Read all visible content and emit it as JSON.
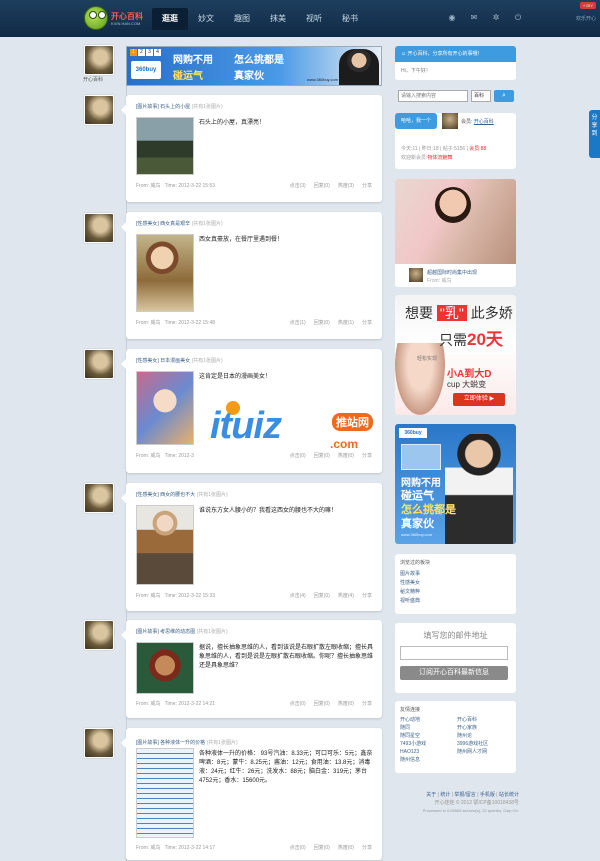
{
  "header": {
    "logo_text": "开心百科",
    "logo_sub": "KXIN.HAN.COM",
    "nav": [
      "逛逛",
      "妙文",
      "趣图",
      "抹美",
      "视听",
      "秘书"
    ],
    "diy": "+ DIY",
    "username": "欢乐开心"
  },
  "banner_ad": {
    "nums": [
      "1",
      "2",
      "3",
      "4"
    ],
    "logo": "360buy",
    "line1": "网购不用",
    "line2": "碰运气",
    "line3": "怎么挑都是",
    "line4": "真家伙",
    "url": "www.360buy.com"
  },
  "avatar_label": "开心百科",
  "posts": [
    {
      "category": "[图片故事]",
      "title": "石头上的小屋",
      "count": "(共有1张图片)",
      "text": "石头上的小屋，真漂亮！",
      "from": "From: 威鸟",
      "time": "Time: 2012-3-22 15:53",
      "actions": [
        "点击(3)",
        "回复(0)",
        "热度(3)",
        "分享"
      ]
    },
    {
      "category": "[性感美女]",
      "title": "西女真是艰辛",
      "count": "(共有1张图片)",
      "text": "西女真豪放，在餐厅里遇到餐！",
      "from": "From: 威鸟",
      "time": "Time: 2012-3-22 15:48",
      "actions": [
        "点击(1)",
        "回复(0)",
        "热度(1)",
        "分享"
      ]
    },
    {
      "category": "[性感美女]",
      "title": "日本漫画美女",
      "count": "(共有1张图片)",
      "text": "这肯定是日本的漫画美女！",
      "from": "From: 威鸟",
      "time": "Time: 2012-3",
      "actions": [
        "点击(0)",
        "回复(0)",
        "热度(0)",
        "分享"
      ]
    },
    {
      "category": "[性感美女]",
      "title": "西女的腰也不大",
      "count": "(共有1张图片)",
      "text": "谁说东方女人腰小的？我看这西女的腰也不大的嘛！",
      "from": "From: 威鸟",
      "time": "Time: 2012-3-22 15:33",
      "actions": [
        "点击(4)",
        "回复(0)",
        "热度(4)",
        "分享"
      ]
    },
    {
      "category": "[图片故事]",
      "title": "考思维的动态图",
      "count": "(共有1张图片)",
      "text": "据说，擅长抽象思维的人，看到该说是右眼扩散左眼收缩；擅长具象思维的人，看到是说是左眼扩散右眼收缩。你呢？擅长抽象思维还是具象思维？",
      "from": "From: 威鸟",
      "time": "Time: 2012-3-22 14:21",
      "actions": [
        "点击(0)",
        "回复(0)",
        "热度(0)",
        "分享"
      ]
    },
    {
      "category": "[图片故事]",
      "title": "各种液体一升的价格",
      "count": "(共有1张图片)",
      "text": "各种液体一升的价格： 93号汽油：8.33元；可口可乐：5元；鑫奈啤酒：8元；蒙牛：8.25元；酱油：12元；食用油：13.8元；消毒液：24元；红牛：26元；洗发水：88元；脑白金：319元；茅台4752元；香水：15600元。",
      "from": "From: 威鸟",
      "time": "Time: 2012-3-22 14:17",
      "actions": [
        "点击(0)",
        "回复(0)",
        "热度(0)",
        "分享"
      ]
    }
  ],
  "sidebar": {
    "top_button": "开心百科，分享所有开心的事哦！",
    "greeting": "Hi，下午好！",
    "search_placeholder": "请输入搜索内容",
    "search_select": "百科",
    "search_icon": "search-icon",
    "hi_button": "哈哈，我一个",
    "hi_user": "会员:",
    "hi_site": "开心百科",
    "stats_line1_a": "今天:11",
    "stats_line1_b": "昨日:18",
    "stats_line1_c": "帖子:5156",
    "stats_line1_d": "会员:88",
    "stats_line2_a": "欢迎新会员:",
    "stats_line2_b": "物体流魅舞",
    "photo_caption": "超越国际时尚集中出现",
    "photo_from": "From: 威鸟",
    "ad1": {
      "l1a": "想要",
      "l1b": "\"乳\"",
      "l1c": "此多娇",
      "l2a": "只需",
      "l2b": "20天",
      "small": "轻松实现",
      "l3": "小A到大D",
      "l4": "cup 大蜕变",
      "button": "立即体验 ▶"
    },
    "ad2": {
      "logo": "360buy",
      "l1": "网购不用",
      "l2": "碰运气",
      "l3": "怎么挑都是",
      "l4": "真家伙",
      "url": "www.360buy.com"
    },
    "links_title": "浏览过的板块",
    "links": [
      "图片故事",
      "性感美女",
      "秘文精粹",
      "视听盛典"
    ],
    "mail_title": "填写您的邮件地址",
    "mail_button": "订阅开心百科最新信息",
    "friends_title": "友情连接",
    "friends_col1": [
      "开心动地",
      "随同",
      "随同星空",
      "7493小游戏",
      "HAO123",
      "随州信息"
    ],
    "friends_col2": [
      "开心百科",
      "开心家族",
      "随州论",
      "3996游戏社区",
      "随州网人才网"
    ],
    "footer_links": [
      "关于",
      "统计",
      "举报/留言",
      "手机版",
      "站长统计"
    ],
    "footer_line2": "开心娃娃 © 2012 鄂ICP备10018438号",
    "footer_line3": "Processed in 0.05566 second(s), 22 queries, Gzip On."
  },
  "share_tab": "分享到",
  "watermark": {
    "main": "ituiz",
    "badge": "推站网",
    "com": ".com"
  }
}
